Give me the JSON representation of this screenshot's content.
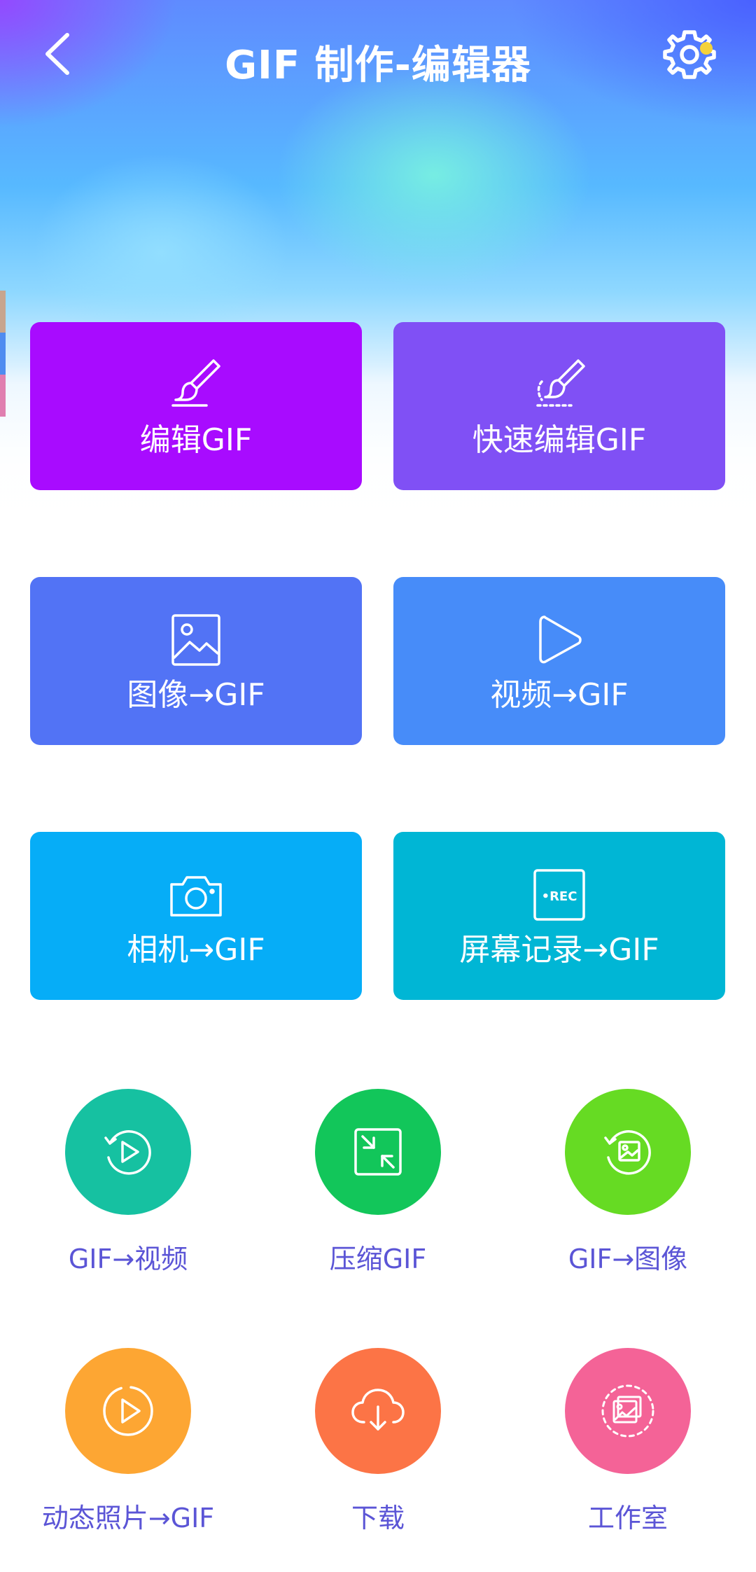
{
  "header": {
    "title": "GIF 制作-编辑器",
    "back_icon": "chevron-left-icon",
    "settings_icon": "gear-icon"
  },
  "colors": {
    "edit": "#A80BFF",
    "quick_edit": "#8050F5",
    "image_to_gif": "#5273F5",
    "video_to_gif": "#478CF9",
    "camera_to_gif": "#06ADF7",
    "screen_to_gif": "#00B6D5",
    "gif_to_video": "#16C1A1",
    "compress": "#12C65A",
    "gif_to_image": "#66DB23",
    "live_photo": "#FDA633",
    "download": "#FC7446",
    "studio": "#F46397",
    "circle_label": "#5B55D6",
    "notify_dot": "#F5D23A"
  },
  "tiles": [
    {
      "label": "编辑GIF",
      "icon": "paintbrush-icon"
    },
    {
      "label": "快速编辑GIF",
      "icon": "brush-dashed-icon"
    },
    {
      "label": "图像→GIF",
      "icon": "image-icon"
    },
    {
      "label": "视频→GIF",
      "icon": "play-icon"
    },
    {
      "label": "相机→GIF",
      "icon": "camera-icon"
    },
    {
      "label": "屏幕记录→GIF",
      "icon": "rec-icon",
      "icon_text": "•REC"
    }
  ],
  "circles": [
    {
      "label": "GIF→视频",
      "icon": "circular-play-icon"
    },
    {
      "label": "压缩GIF",
      "icon": "compress-icon"
    },
    {
      "label": "GIF→图像",
      "icon": "circular-image-icon"
    },
    {
      "label": "动态照片→GIF",
      "icon": "live-photo-icon"
    },
    {
      "label": "下载",
      "icon": "cloud-download-icon"
    },
    {
      "label": "工作室",
      "icon": "gallery-stack-icon"
    }
  ]
}
